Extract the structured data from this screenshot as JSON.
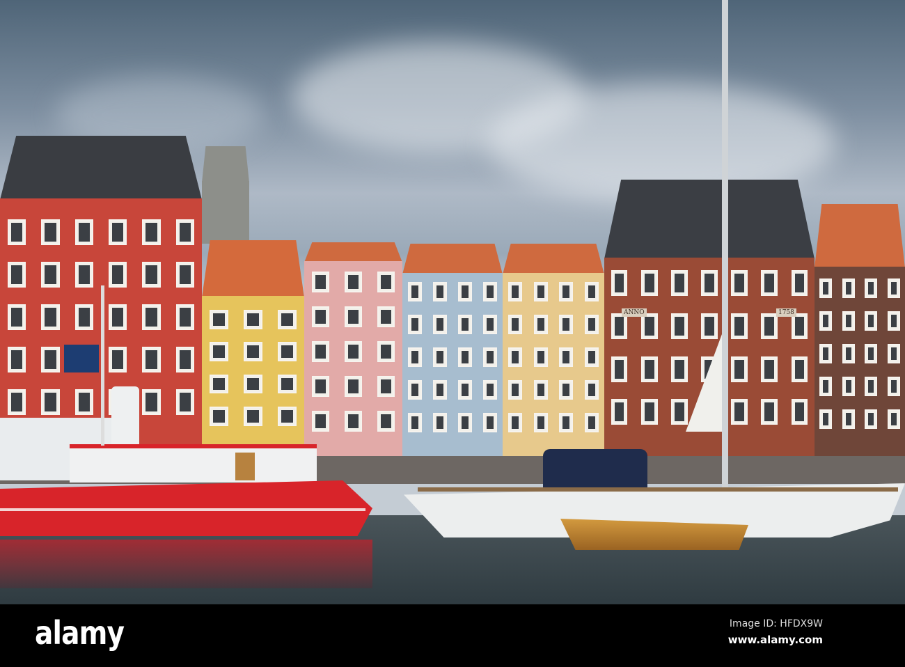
{
  "photo": {
    "plaque_left": "ANNO",
    "plaque_right": "1758",
    "colors": {
      "red_house": "#c8463a",
      "yellow_house": "#e6c45c",
      "pink_house": "#e2aaa8",
      "blue_house": "#a7bdcf",
      "tan_house": "#e7c98c",
      "brick_house": "#9a4b36",
      "dark_brick_house": "#6f4639",
      "water": "#38464d",
      "boat_red": "#d8242a"
    }
  },
  "watermark": {
    "logo": "alamy",
    "image_id": "Image ID: HFDX9W",
    "site": "www.alamy.com"
  }
}
